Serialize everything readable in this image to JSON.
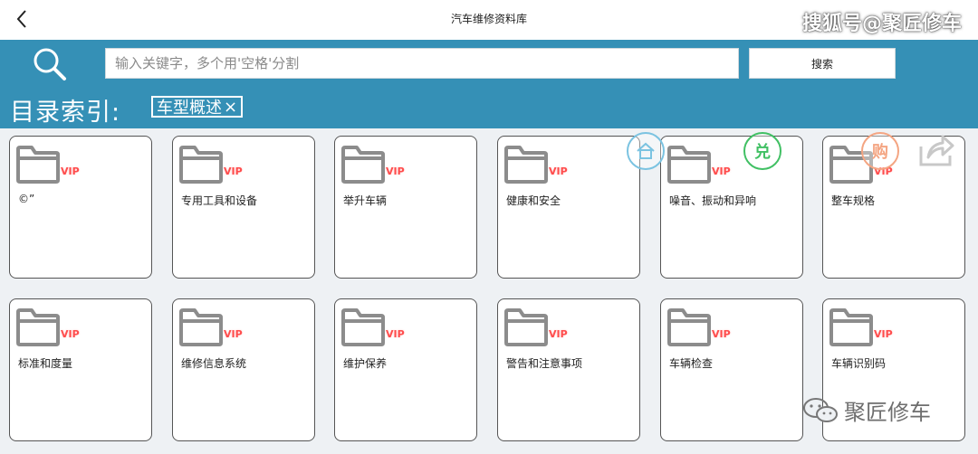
{
  "header": {
    "title": "汽车维修资料库",
    "back_icon": "chevron-left-icon"
  },
  "watermark_top": "搜狐号@聚匠修车",
  "search": {
    "placeholder": "输入关键字，多个用'空格'分割",
    "button_label": "搜索",
    "icon": "search-icon"
  },
  "directory": {
    "label": "目录索引:",
    "chip_label": "车型概述",
    "chip_close": "×"
  },
  "vip_badge": "VIP",
  "cards": [
    {
      "label": "©”"
    },
    {
      "label": "专用工具和设备"
    },
    {
      "label": "举升车辆"
    },
    {
      "label": "健康和安全"
    },
    {
      "label": "噪音、振动和异响"
    },
    {
      "label": "整车规格"
    },
    {
      "label": "标准和度量"
    },
    {
      "label": "维修信息系统"
    },
    {
      "label": "维护保养"
    },
    {
      "label": "警告和注意事项"
    },
    {
      "label": "车辆检查"
    },
    {
      "label": "车辆识别码"
    }
  ],
  "floating": {
    "home": "hone-icon",
    "exchange_text": "兑",
    "buy_text": "购",
    "share": "share-icon"
  },
  "watermark_bottom": {
    "icon": "wechat-icon",
    "text": "聚匠修车"
  },
  "colors": {
    "accent": "#3590b6",
    "vip": "#ff4d4d",
    "folder": "#8c8c8c"
  }
}
